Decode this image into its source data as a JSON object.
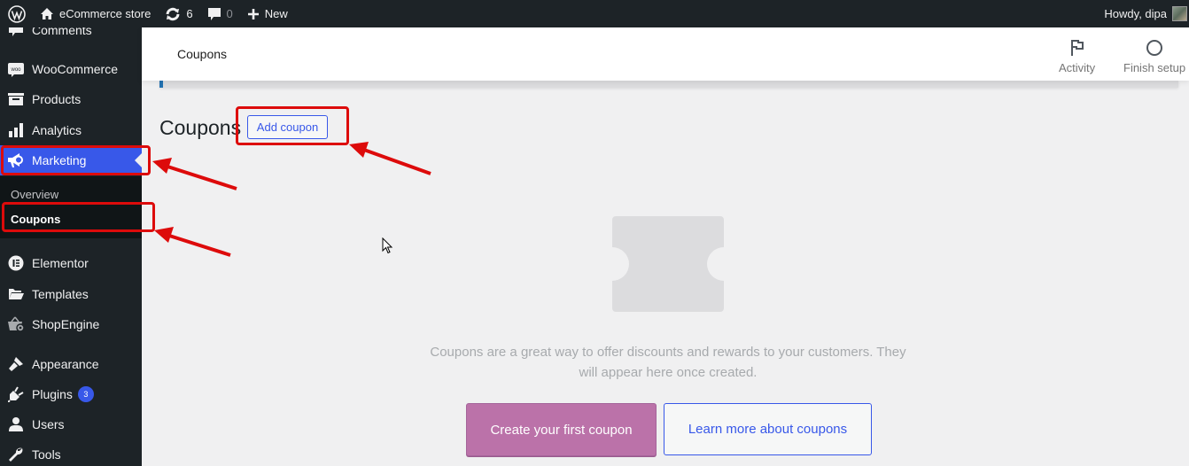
{
  "admin_bar": {
    "site_name": "eCommerce store",
    "updates_count": "6",
    "comments_count": "0",
    "new_label": "New",
    "greeting": "Howdy, dipa"
  },
  "sidebar": {
    "items": [
      {
        "label": "Comments",
        "icon": "comment-icon"
      },
      {
        "label": "WooCommerce",
        "icon": "woo-icon"
      },
      {
        "label": "Products",
        "icon": "archive-icon"
      },
      {
        "label": "Analytics",
        "icon": "bar-chart-icon"
      },
      {
        "label": "Marketing",
        "icon": "megaphone-icon",
        "active": true
      },
      {
        "label": "Elementor",
        "icon": "elementor-icon"
      },
      {
        "label": "Templates",
        "icon": "folder-icon"
      },
      {
        "label": "ShopEngine",
        "icon": "basket-gear-icon"
      },
      {
        "label": "Appearance",
        "icon": "paintbrush-icon"
      },
      {
        "label": "Plugins",
        "icon": "plug-icon",
        "badge": "3"
      },
      {
        "label": "Users",
        "icon": "user-icon"
      },
      {
        "label": "Tools",
        "icon": "wrench-icon"
      }
    ],
    "submenu": [
      {
        "label": "Overview"
      },
      {
        "label": "Coupons",
        "current": true
      }
    ]
  },
  "header": {
    "title": "Coupons",
    "activity_label": "Activity",
    "finish_setup_label": "Finish setup"
  },
  "main": {
    "page_title": "Coupons",
    "add_coupon_label": "Add coupon",
    "empty_message": "Coupons are a great way to offer discounts and rewards to your customers. They will appear here once created.",
    "create_first_label": "Create your first coupon",
    "learn_more_label": "Learn more about coupons"
  },
  "colors": {
    "accent": "#3858e9",
    "primary_button": "#bb72a9",
    "annotation_red": "#dd0b0b",
    "admin_bar_bg": "#1d2327"
  }
}
